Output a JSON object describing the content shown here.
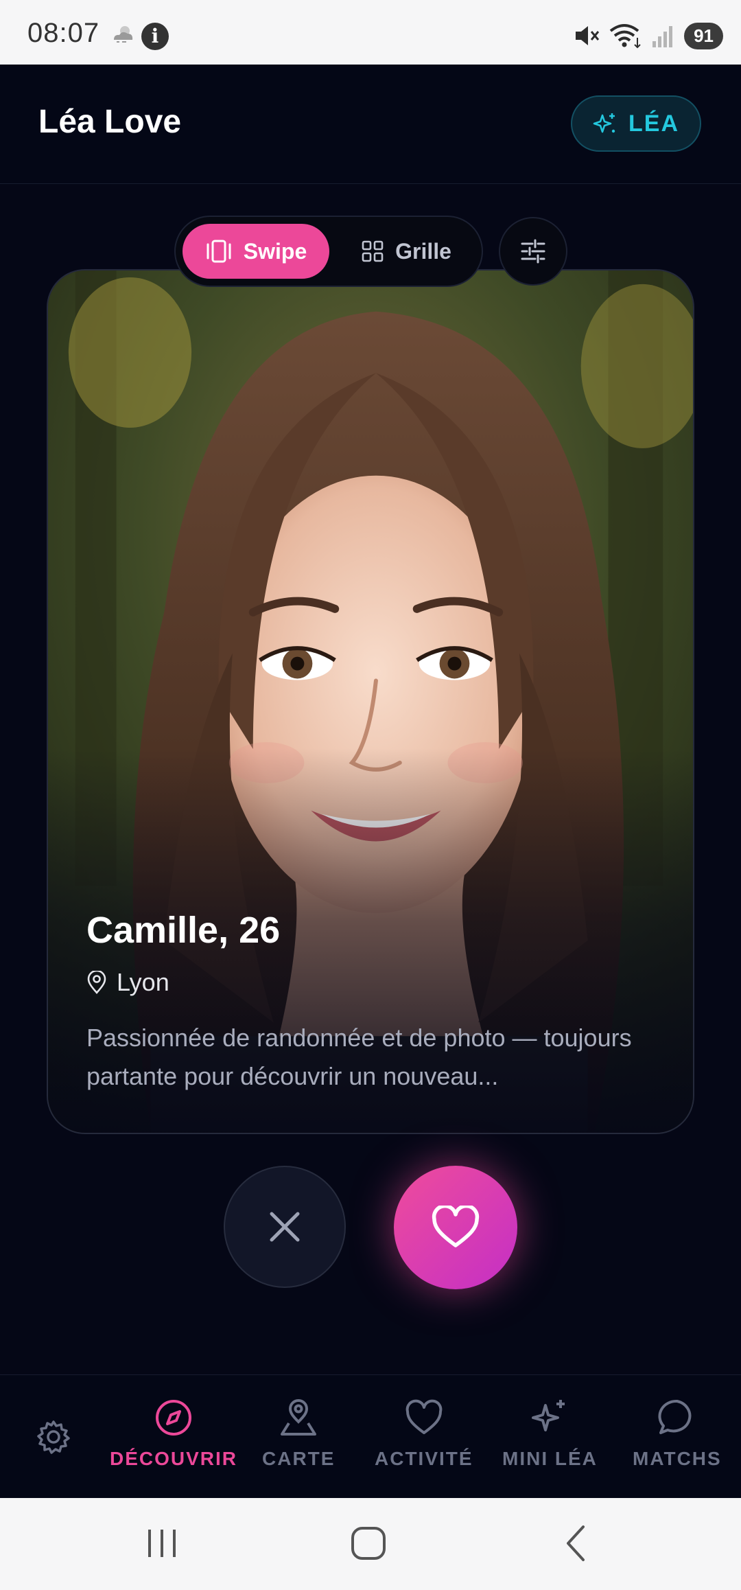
{
  "status_bar": {
    "time": "08:07",
    "info_glyph": "i",
    "battery": "91",
    "icons": [
      "weather-icon",
      "info-icon",
      "mute-icon",
      "wifi-icon",
      "signal-icon",
      "battery-icon"
    ]
  },
  "header": {
    "title": "Léa Love",
    "lea_button": "LÉA"
  },
  "mode_toggle": {
    "swipe_label": "Swipe",
    "grid_label": "Grille",
    "active": "Swipe"
  },
  "profile": {
    "name_age": "Camille, 26",
    "city": "Lyon",
    "bio": "Passionnée de randonnée et de photo — toujours partante pour découvrir un nouveau..."
  },
  "bottom_nav": {
    "items": [
      {
        "label": "DÉCOUVRIR",
        "icon": "compass-icon",
        "active": true
      },
      {
        "label": "CARTE",
        "icon": "map-pin-icon",
        "active": false
      },
      {
        "label": "ACTIVITÉ",
        "icon": "heart-icon",
        "active": false
      },
      {
        "label": "MINI LÉA",
        "icon": "sparkles-icon",
        "active": false
      },
      {
        "label": "MATCHS",
        "icon": "chat-icon",
        "active": false
      }
    ]
  },
  "colors": {
    "background": "#050716",
    "accent_pink": "#ec4899",
    "accent_cyan": "#24c8de",
    "nav_inactive": "#6c7287"
  }
}
